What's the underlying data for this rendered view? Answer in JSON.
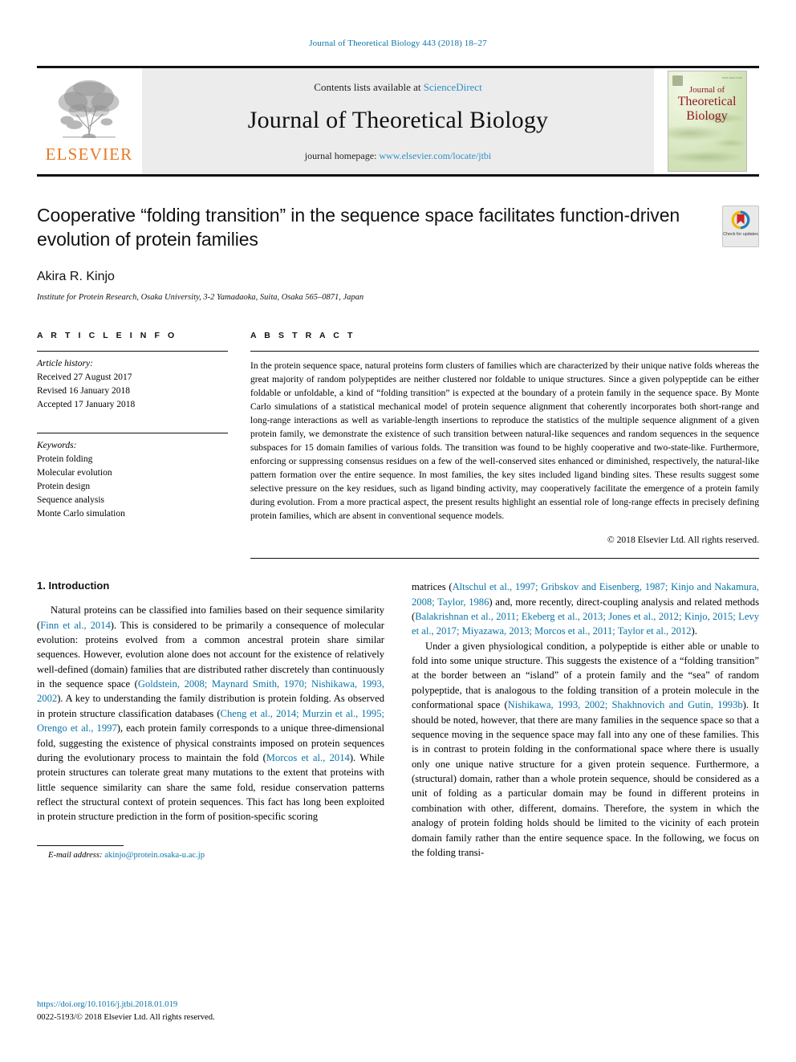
{
  "running_head": "Journal of Theoretical Biology 443 (2018) 18–27",
  "masthead": {
    "contents_prefix": "Contents lists available at ",
    "sciencedirect": "ScienceDirect",
    "journal_title": "Journal of Theoretical Biology",
    "homepage_prefix": "journal homepage: ",
    "homepage_url": "www.elsevier.com/locate/jtbi",
    "publisher_wordmark": "ELSEVIER",
    "cover": {
      "line1": "Journal of",
      "line2": "Theoretical",
      "line3": "Biology",
      "corner_note": "ISSN 0022-5193"
    },
    "link_color": "#2f8fc4"
  },
  "article": {
    "title": "Cooperative “folding transition” in the sequence space facilitates function-driven evolution of protein families",
    "authors": "Akira R. Kinjo",
    "affiliation": "Institute for Protein Research, Osaka University, 3-2 Yamadaoka, Suita, Osaka 565–0871, Japan",
    "crossmark_label": "Check for updates"
  },
  "article_info": {
    "heading": "A R T I C L E   I N F O",
    "history_label": "Article history:",
    "history": [
      "Received 27 August 2017",
      "Revised 16 January 2018",
      "Accepted 17 January 2018"
    ],
    "keywords_label": "Keywords:",
    "keywords": [
      "Protein folding",
      "Molecular evolution",
      "Protein design",
      "Sequence analysis",
      "Monte Carlo simulation"
    ]
  },
  "abstract": {
    "heading": "A B S T R A C T",
    "text": "In the protein sequence space, natural proteins form clusters of families which are characterized by their unique native folds whereas the great majority of random polypeptides are neither clustered nor foldable to unique structures. Since a given polypeptide can be either foldable or unfoldable, a kind of “folding transition” is expected at the boundary of a protein family in the sequence space. By Monte Carlo simulations of a statistical mechanical model of protein sequence alignment that coherently incorporates both short-range and long-range interactions as well as variable-length insertions to reproduce the statistics of the multiple sequence alignment of a given protein family, we demonstrate the existence of such transition between natural-like sequences and random sequences in the sequence subspaces for 15 domain families of various folds. The transition was found to be highly cooperative and two-state-like. Furthermore, enforcing or suppressing consensus residues on a few of the well-conserved sites enhanced or diminished, respectively, the natural-like pattern formation over the entire sequence. In most families, the key sites included ligand binding sites. These results suggest some selective pressure on the key residues, such as ligand binding activity, may cooperatively facilitate the emergence of a protein family during evolution. From a more practical aspect, the present results highlight an essential role of long-range effects in precisely defining protein families, which are absent in conventional sequence models.",
    "copyright": "© 2018 Elsevier Ltd. All rights reserved."
  },
  "introduction": {
    "heading": "1. Introduction",
    "left_paragraph_1": {
      "seg1": "Natural proteins can be classified into families based on their sequence similarity (",
      "cit1": "Finn et al., 2014",
      "seg2": "). This is considered to be primarily a consequence of molecular evolution: proteins evolved from a common ancestral protein share similar sequences. However, evolution alone does not account for the existence of relatively well-defined (domain) families that are distributed rather discretely than continuously in the sequence space (",
      "cit2": "Goldstein, 2008; Maynard Smith, 1970; Nishikawa, 1993, 2002",
      "seg3": "). A key to understanding the family distribution is protein folding. As observed in protein structure classification databases (",
      "cit3": "Cheng et al., 2014; Murzin et al., 1995; Orengo et al., 1997",
      "seg4": "), each protein family corresponds to a unique three-dimensional fold, suggesting the existence of physical constraints imposed on protein sequences during the evolutionary process to maintain the fold (",
      "cit4": "Morcos et al., 2014",
      "seg5": "). While protein structures can tolerate great many mutations to the extent that proteins with little sequence similarity can share the same fold, residue conservation patterns reflect the structural context of protein sequences. This fact has long been exploited in protein structure prediction in the form of position-specific scoring"
    },
    "right_paragraph_1": {
      "seg1": "matrices (",
      "cit1": "Altschul et al., 1997; Gribskov and Eisenberg, 1987; Kinjo and Nakamura, 2008; Taylor, 1986",
      "seg2": ") and, more recently, direct-coupling analysis and related methods (",
      "cit2": "Balakrishnan et al., 2011; Ekeberg et al., 2013; Jones et al., 2012; Kinjo, 2015; Levy et al., 2017; Miyazawa, 2013; Morcos et al., 2011; Taylor et al., 2012",
      "seg3": ")."
    },
    "right_paragraph_2": {
      "seg1": "Under a given physiological condition, a polypeptide is either able or unable to fold into some unique structure. This suggests the existence of a “folding transition” at the border between an “island” of a protein family and the “sea” of random polypeptide, that is analogous to the folding transition of a protein molecule in the conformational space (",
      "cit1": "Nishikawa, 1993, 2002; Shakhnovich and Gutin, 1993b",
      "seg2": "). It should be noted, however, that there are many families in the sequence space so that a sequence moving in the sequence space may fall into any one of these families. This is in contrast to protein folding in the conformational space where there is usually only one unique native structure for a given protein sequence. Furthermore, a (structural) domain, rather than a whole protein sequence, should be considered as a unit of folding as a particular domain may be found in different proteins in combination with other, different, domains. Therefore, the system in which the analogy of protein folding holds should be limited to the vicinity of each protein domain family rather than the entire sequence space. In the following, we focus on the folding transi-"
    }
  },
  "footnote": {
    "label": "E-mail address:",
    "email": "akinjo@protein.osaka-u.ac.jp"
  },
  "page_footer": {
    "doi": "https://doi.org/10.1016/j.jtbi.2018.01.019",
    "issn_line": "0022-5193/© 2018 Elsevier Ltd. All rights reserved."
  },
  "colors": {
    "link": "#0a74a8",
    "elsevier_orange": "#E87722",
    "cover_red": "#8e1b22"
  }
}
